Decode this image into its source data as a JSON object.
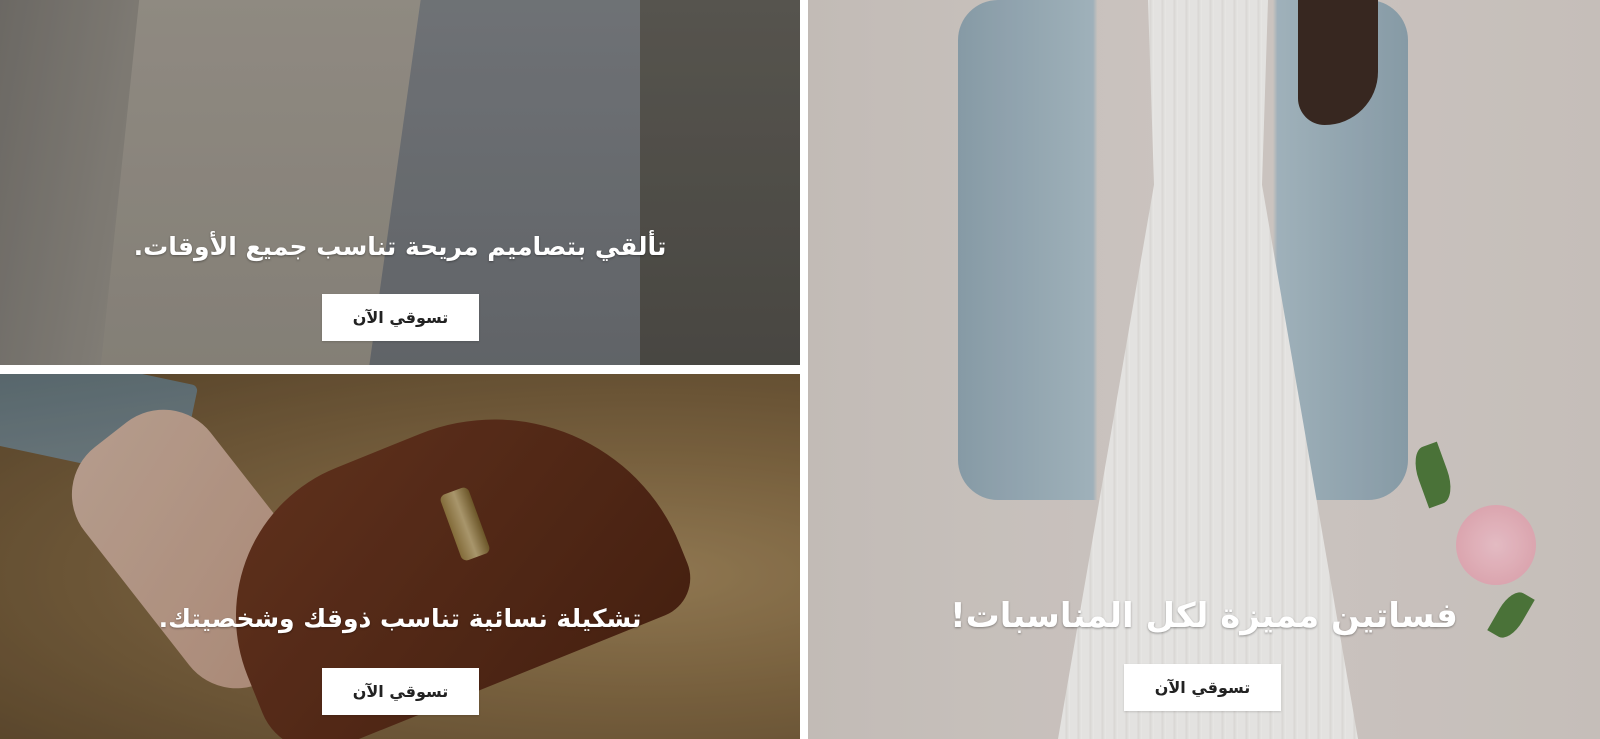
{
  "promos": [
    {
      "image": "coats-with-crescent-embroidery",
      "headline": "تألقي بتصاميم مريحة تناسب جميع الأوقات.",
      "cta_label": "تسوقي الآن"
    },
    {
      "image": "brown-leather-loafer",
      "headline": "تشكيلة نسائية تناسب ذوقك وشخصيتك.",
      "cta_label": "تسوقي الآن"
    },
    {
      "image": "white-pleated-dress",
      "headline": "فساتين مميزة لكل المناسبات!",
      "cta_label": "تسوقي الآن"
    }
  ],
  "colors": {
    "overlay": "#00000038",
    "caption_text": "#ffffff",
    "button_bg": "#ffffff",
    "button_text": "#222222"
  }
}
